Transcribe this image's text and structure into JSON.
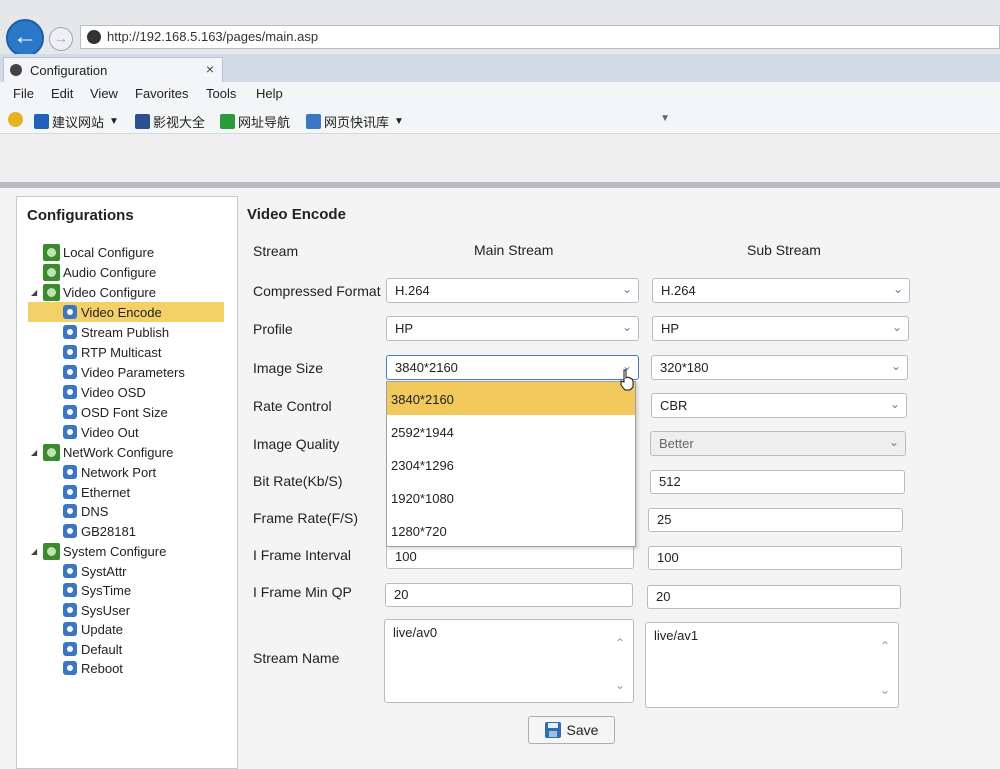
{
  "browser": {
    "url": "http://192.168.5.163/pages/main.asp",
    "tab_title": "Configuration",
    "tab_close": "×",
    "menu": [
      "File",
      "Edit",
      "View",
      "Favorites",
      "Tools",
      "Help"
    ],
    "favorites": [
      {
        "label": "建议网站",
        "dropdown": true,
        "color": "#1f63b8"
      },
      {
        "label": "影视大全",
        "dropdown": false,
        "color": "#2b4f8f"
      },
      {
        "label": "网址导航",
        "dropdown": false,
        "color": "#2a9a3a"
      },
      {
        "label": "网页快讯库",
        "dropdown": true,
        "color": "#3a78c4"
      }
    ],
    "fav_more": "▼"
  },
  "sidebar": {
    "title": "Configurations",
    "items": [
      {
        "label": "Local Configure",
        "level": 0,
        "type": "folder",
        "toggle": ""
      },
      {
        "label": "Audio Configure",
        "level": 0,
        "type": "folder",
        "toggle": ""
      },
      {
        "label": "Video Configure",
        "level": 0,
        "type": "folder",
        "toggle": "◢"
      },
      {
        "label": "Video Encode",
        "level": 1,
        "type": "gear",
        "selected": true
      },
      {
        "label": "Stream Publish",
        "level": 1,
        "type": "gear"
      },
      {
        "label": "RTP Multicast",
        "level": 1,
        "type": "gear"
      },
      {
        "label": "Video Parameters",
        "level": 1,
        "type": "gear"
      },
      {
        "label": "Video OSD",
        "level": 1,
        "type": "gear"
      },
      {
        "label": "OSD Font Size",
        "level": 1,
        "type": "gear"
      },
      {
        "label": "Video Out",
        "level": 1,
        "type": "gear"
      },
      {
        "label": "NetWork Configure",
        "level": 0,
        "type": "folder",
        "toggle": "◢"
      },
      {
        "label": "Network Port",
        "level": 1,
        "type": "gear"
      },
      {
        "label": "Ethernet",
        "level": 1,
        "type": "gear"
      },
      {
        "label": "DNS",
        "level": 1,
        "type": "gear"
      },
      {
        "label": "GB28181",
        "level": 1,
        "type": "gear"
      },
      {
        "label": "System Configure",
        "level": 0,
        "type": "folder",
        "toggle": "◢"
      },
      {
        "label": "SystAttr",
        "level": 1,
        "type": "gear"
      },
      {
        "label": "SysTime",
        "level": 1,
        "type": "gear"
      },
      {
        "label": "SysUser",
        "level": 1,
        "type": "gear"
      },
      {
        "label": "Update",
        "level": 1,
        "type": "gear"
      },
      {
        "label": "Default",
        "level": 1,
        "type": "gear"
      },
      {
        "label": "Reboot",
        "level": 1,
        "type": "gear"
      }
    ]
  },
  "encode": {
    "title": "Video Encode",
    "stream_label": "Stream",
    "main_header": "Main Stream",
    "sub_header": "Sub Stream",
    "labels": {
      "compressed_format": "Compressed Format",
      "profile": "Profile",
      "image_size": "Image Size",
      "rate_control": "Rate Control",
      "image_quality": "Image Quality",
      "bit_rate": "Bit Rate(Kb/S)",
      "frame_rate": "Frame Rate(F/S)",
      "i_frame_interval": "I Frame Interval",
      "i_frame_min_qp": "I Frame Min QP",
      "stream_name": "Stream Name"
    },
    "main": {
      "compressed_format": "H.264",
      "profile": "HP",
      "image_size": "3840*2160",
      "i_frame_interval": "100",
      "i_frame_min_qp": "20",
      "stream_name": "live/av0"
    },
    "sub": {
      "compressed_format": "H.264",
      "profile": "HP",
      "image_size": "320*180",
      "rate_control": "CBR",
      "image_quality": "Better",
      "bit_rate": "512",
      "frame_rate": "25",
      "i_frame_interval": "100",
      "i_frame_min_qp": "20",
      "stream_name": "live/av1"
    },
    "image_size_options": [
      "3840*2160",
      "2592*1944",
      "2304*1296",
      "1920*1080",
      "1280*720"
    ],
    "image_size_highlighted": "3840*2160",
    "save_label": "Save",
    "arrow_glyph": "⌄",
    "scroll_up_glyph": "⌃",
    "scroll_down_glyph": "⌄"
  }
}
